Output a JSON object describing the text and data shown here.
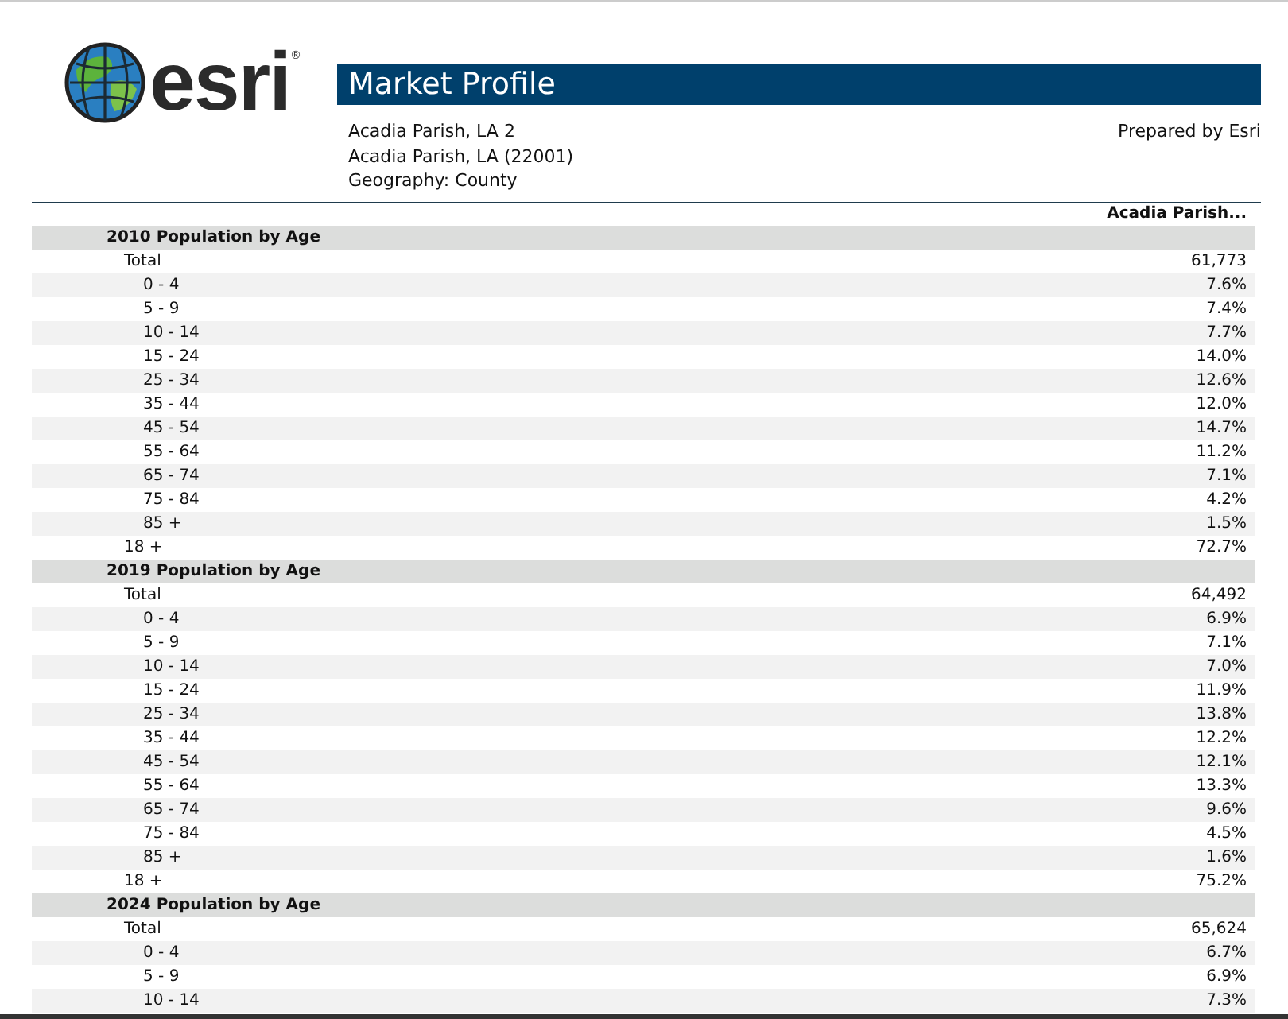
{
  "logo": {
    "text": "esri",
    "mark": "®"
  },
  "title": "Market Profile",
  "info_lines": [
    "Acadia Parish, LA 2",
    "Acadia Parish, LA (22001)",
    "Geography: County"
  ],
  "prepared_by": "Prepared by Esri",
  "table": {
    "columns": [
      "Acadia Parish..."
    ],
    "sections": [
      {
        "title": "2010 Population by Age",
        "rows": [
          {
            "kind": "total",
            "label": "Total",
            "value": "61,773"
          },
          {
            "kind": "bracket",
            "label": "0 - 4",
            "value": "7.6%"
          },
          {
            "kind": "bracket",
            "label": "5 - 9",
            "value": "7.4%"
          },
          {
            "kind": "bracket",
            "label": "10 - 14",
            "value": "7.7%"
          },
          {
            "kind": "bracket",
            "label": "15 - 24",
            "value": "14.0%"
          },
          {
            "kind": "bracket",
            "label": "25 - 34",
            "value": "12.6%"
          },
          {
            "kind": "bracket",
            "label": "35 - 44",
            "value": "12.0%"
          },
          {
            "kind": "bracket",
            "label": "45 - 54",
            "value": "14.7%"
          },
          {
            "kind": "bracket",
            "label": "55 - 64",
            "value": "11.2%"
          },
          {
            "kind": "bracket",
            "label": "65 - 74",
            "value": "7.1%"
          },
          {
            "kind": "bracket",
            "label": "75 - 84",
            "value": "4.2%"
          },
          {
            "kind": "bracket",
            "label": "85 +",
            "value": "1.5%"
          },
          {
            "kind": "total",
            "label": "18 +",
            "value": "72.7%"
          }
        ]
      },
      {
        "title": "2019 Population by Age",
        "rows": [
          {
            "kind": "total",
            "label": "Total",
            "value": "64,492"
          },
          {
            "kind": "bracket",
            "label": "0 - 4",
            "value": "6.9%"
          },
          {
            "kind": "bracket",
            "label": "5 - 9",
            "value": "7.1%"
          },
          {
            "kind": "bracket",
            "label": "10 - 14",
            "value": "7.0%"
          },
          {
            "kind": "bracket",
            "label": "15 - 24",
            "value": "11.9%"
          },
          {
            "kind": "bracket",
            "label": "25 - 34",
            "value": "13.8%"
          },
          {
            "kind": "bracket",
            "label": "35 - 44",
            "value": "12.2%"
          },
          {
            "kind": "bracket",
            "label": "45 - 54",
            "value": "12.1%"
          },
          {
            "kind": "bracket",
            "label": "55 - 64",
            "value": "13.3%"
          },
          {
            "kind": "bracket",
            "label": "65 - 74",
            "value": "9.6%"
          },
          {
            "kind": "bracket",
            "label": "75 - 84",
            "value": "4.5%"
          },
          {
            "kind": "bracket",
            "label": "85 +",
            "value": "1.6%"
          },
          {
            "kind": "total",
            "label": "18 +",
            "value": "75.2%"
          }
        ]
      },
      {
        "title": "2024 Population by Age",
        "rows": [
          {
            "kind": "total",
            "label": "Total",
            "value": "65,624"
          },
          {
            "kind": "bracket",
            "label": "0 - 4",
            "value": "6.7%"
          },
          {
            "kind": "bracket",
            "label": "5 - 9",
            "value": "6.9%"
          },
          {
            "kind": "bracket",
            "label": "10 - 14",
            "value": "7.3%"
          }
        ]
      }
    ]
  }
}
